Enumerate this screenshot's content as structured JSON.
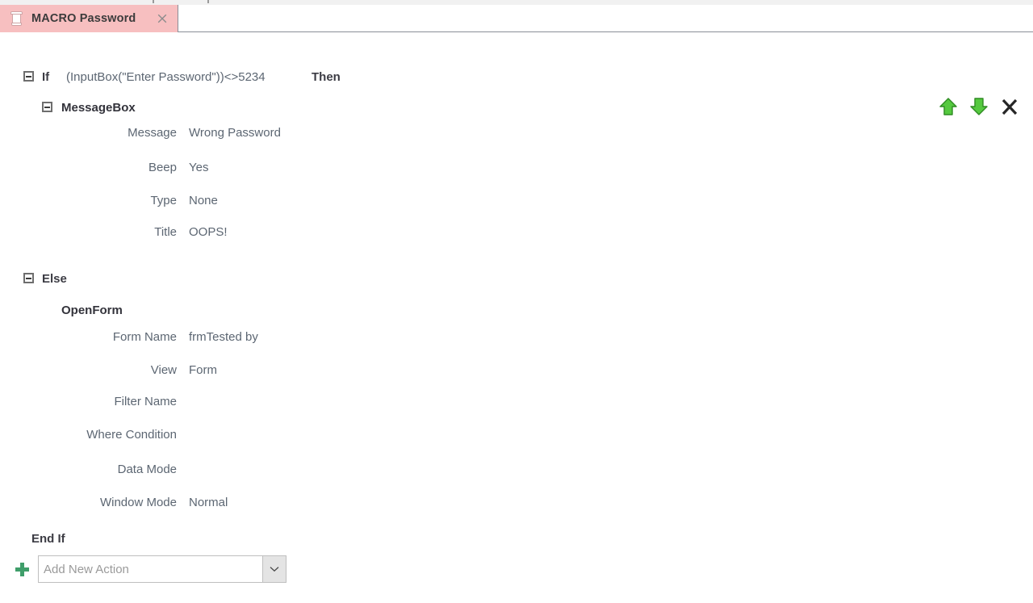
{
  "window": {
    "tab": {
      "label": "MACRO Password",
      "icon": "macro-scroll-icon",
      "close_icon": "close-icon",
      "background_color": "#f7bfc0"
    }
  },
  "row_actions": [
    {
      "name": "move-up-button",
      "icon": "arrow-up-icon",
      "color": "#4fc23c"
    },
    {
      "name": "move-down-button",
      "icon": "arrow-down-icon",
      "color": "#4fc23c"
    },
    {
      "name": "delete-button",
      "icon": "close-x-icon",
      "color": "#262626"
    }
  ],
  "macro": {
    "if_keyword": "If",
    "if_condition": "(InputBox(\"Enter Password\"))<>5234",
    "then_keyword": "Then",
    "else_keyword": "Else",
    "end_if_keyword": "End If",
    "message_box": {
      "name": "MessageBox",
      "arguments": [
        {
          "label": "Message",
          "value": "Wrong Password"
        },
        {
          "label": "Beep",
          "value": "Yes"
        },
        {
          "label": "Type",
          "value": "None"
        },
        {
          "label": "Title",
          "value": "OOPS!"
        }
      ]
    },
    "open_form": {
      "name": "OpenForm",
      "arguments": [
        {
          "label": "Form Name",
          "value": "frmTested by"
        },
        {
          "label": "View",
          "value": "Form"
        },
        {
          "label": "Filter Name",
          "value": ""
        },
        {
          "label": "Where Condition",
          "value": ""
        },
        {
          "label": "Data Mode",
          "value": ""
        },
        {
          "label": "Window Mode",
          "value": "Normal"
        }
      ]
    }
  },
  "add_action": {
    "add_icon": "plus-icon",
    "placeholder": "Add New Action",
    "value": "",
    "dropdown_icon": "chevron-down-icon"
  }
}
